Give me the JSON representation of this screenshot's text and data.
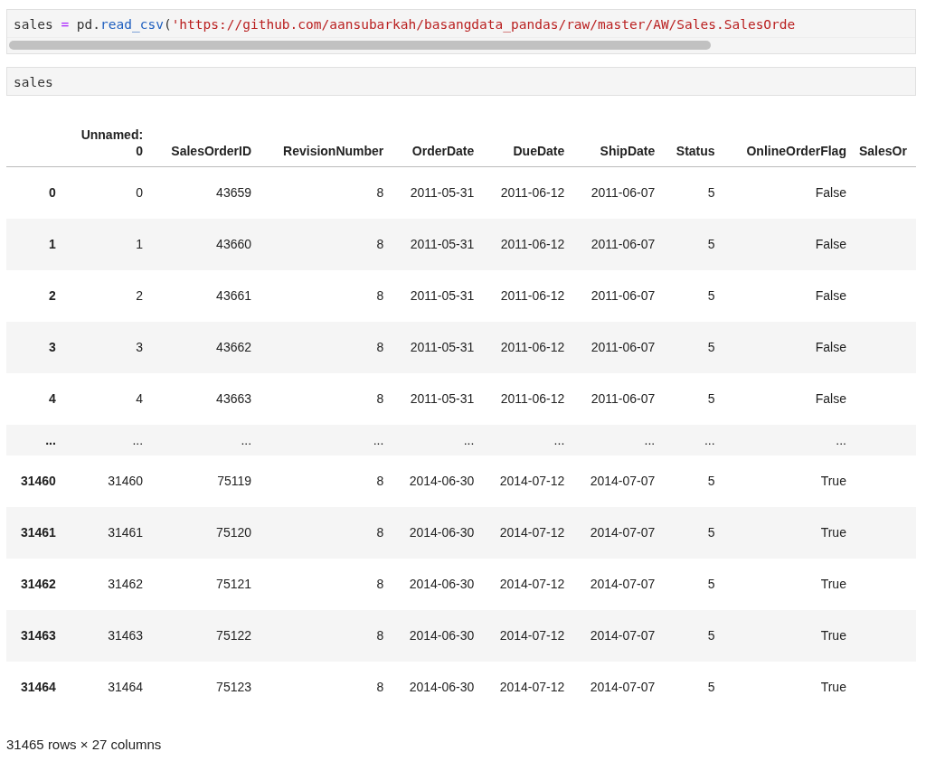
{
  "cells": [
    {
      "kind": "code",
      "scrollbar": true,
      "tokens": [
        {
          "kind": "name",
          "text": "sales"
        },
        {
          "kind": "operator",
          "text": " = "
        },
        {
          "kind": "name",
          "text": "pd."
        },
        {
          "kind": "function",
          "text": "read_csv"
        },
        {
          "kind": "name",
          "text": "("
        },
        {
          "kind": "string",
          "text": "'https://github.com/aansubarkah/basangdata_pandas/raw/master/AW/Sales.SalesOrde"
        }
      ]
    },
    {
      "kind": "code",
      "scrollbar": false,
      "tokens": [
        {
          "kind": "name",
          "text": "sales"
        }
      ]
    }
  ],
  "table": {
    "columns": [
      "",
      "Unnamed:\n0",
      "SalesOrderID",
      "RevisionNumber",
      "OrderDate",
      "DueDate",
      "ShipDate",
      "Status",
      "OnlineOrderFlag",
      "SalesOr"
    ],
    "rows": [
      [
        "0",
        "0",
        "43659",
        "8",
        "2011-05-31",
        "2011-06-12",
        "2011-06-07",
        "5",
        "False"
      ],
      [
        "1",
        "1",
        "43660",
        "8",
        "2011-05-31",
        "2011-06-12",
        "2011-06-07",
        "5",
        "False"
      ],
      [
        "2",
        "2",
        "43661",
        "8",
        "2011-05-31",
        "2011-06-12",
        "2011-06-07",
        "5",
        "False"
      ],
      [
        "3",
        "3",
        "43662",
        "8",
        "2011-05-31",
        "2011-06-12",
        "2011-06-07",
        "5",
        "False"
      ],
      [
        "4",
        "4",
        "43663",
        "8",
        "2011-05-31",
        "2011-06-12",
        "2011-06-07",
        "5",
        "False"
      ],
      [
        "...",
        "...",
        "...",
        "...",
        "...",
        "...",
        "...",
        "...",
        "..."
      ],
      [
        "31460",
        "31460",
        "75119",
        "8",
        "2014-06-30",
        "2014-07-12",
        "2014-07-07",
        "5",
        "True"
      ],
      [
        "31461",
        "31461",
        "75120",
        "8",
        "2014-06-30",
        "2014-07-12",
        "2014-07-07",
        "5",
        "True"
      ],
      [
        "31462",
        "31462",
        "75121",
        "8",
        "2014-06-30",
        "2014-07-12",
        "2014-07-07",
        "5",
        "True"
      ],
      [
        "31463",
        "31463",
        "75122",
        "8",
        "2014-06-30",
        "2014-07-12",
        "2014-07-07",
        "5",
        "True"
      ],
      [
        "31464",
        "31464",
        "75123",
        "8",
        "2014-06-30",
        "2014-07-12",
        "2014-07-07",
        "5",
        "True"
      ]
    ]
  },
  "shape_note": "31465 rows × 27 columns"
}
